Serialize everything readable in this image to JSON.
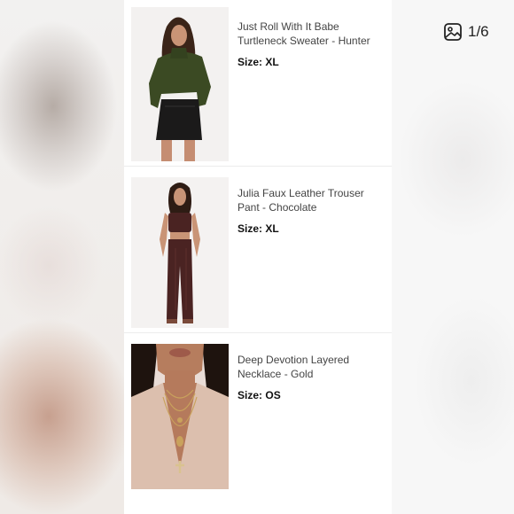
{
  "gallery": {
    "counter": "1/6",
    "counter_icon": "image-gallery-icon"
  },
  "items": [
    {
      "name": "Just Roll With It Babe Turtleneck Sweater - Hunter",
      "size_label": "Size:",
      "size_value": "XL"
    },
    {
      "name": "Julia Faux Leather Trouser Pant - Chocolate",
      "size_label": "Size:",
      "size_value": "XL"
    },
    {
      "name": "Deep Devotion Layered Necklace - Gold",
      "size_label": "Size:",
      "size_value": "OS"
    }
  ],
  "colors": {
    "sweater": "#3b4a23",
    "skirt": "#1b1a1a",
    "leather_brown": "#4a2322",
    "shirt": "#dcbfae",
    "gold": "#c9a25c"
  }
}
